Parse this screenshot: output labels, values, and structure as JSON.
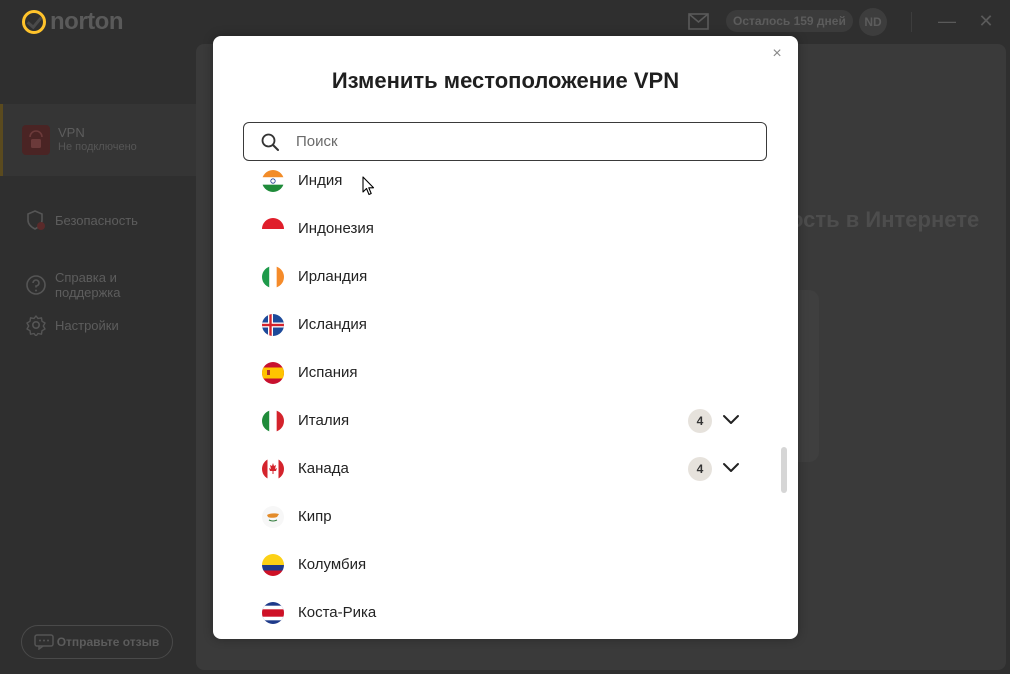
{
  "app": {
    "brand": "norton",
    "trial_badge": "Осталось 159 дней",
    "avatar_initials": "ND",
    "accent": "#ffc32b"
  },
  "sidebar": {
    "vpn": {
      "title": "VPN",
      "status": "Не подключено"
    },
    "items": [
      {
        "label": "Безопасность",
        "icon": "shield-alert-icon"
      },
      {
        "label": "Справка и поддержка",
        "icon": "help-circle-icon"
      },
      {
        "label": "Настройки",
        "icon": "gear-icon"
      }
    ],
    "feedback_label": "Отправьте отзыв"
  },
  "main": {
    "heading_fragment": "ость в Интернете"
  },
  "modal": {
    "title": "Изменить местоположение VPN",
    "close": "×",
    "search_placeholder": "Поиск",
    "countries": [
      {
        "name": "Индия",
        "flag": "flag-india-icon"
      },
      {
        "name": "Индонезия",
        "flag": "flag-indonesia-icon"
      },
      {
        "name": "Ирландия",
        "flag": "flag-ireland-icon"
      },
      {
        "name": "Исландия",
        "flag": "flag-iceland-icon"
      },
      {
        "name": "Испания",
        "flag": "flag-spain-icon"
      },
      {
        "name": "Италия",
        "flag": "flag-italy-icon",
        "count": "4"
      },
      {
        "name": "Канада",
        "flag": "flag-canada-icon",
        "count": "4"
      },
      {
        "name": "Кипр",
        "flag": "flag-cyprus-icon"
      },
      {
        "name": "Колумбия",
        "flag": "flag-colombia-icon"
      },
      {
        "name": "Коста-Рика",
        "flag": "flag-costa-rica-icon"
      }
    ]
  }
}
